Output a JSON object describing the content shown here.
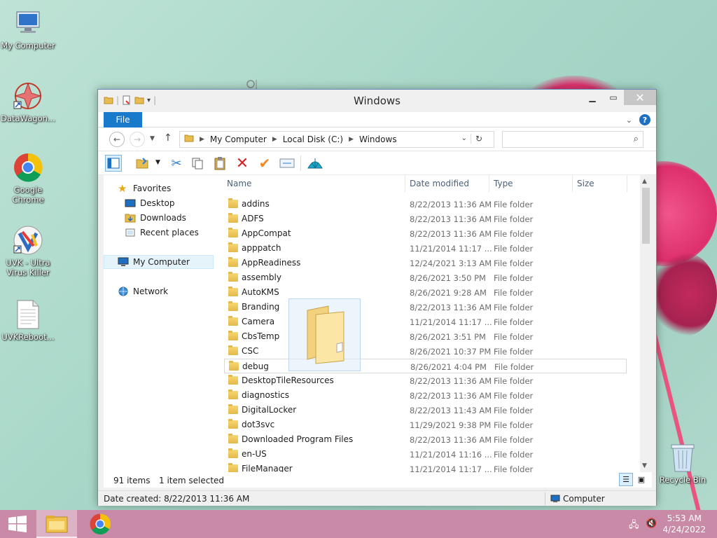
{
  "desktop": {
    "icons": [
      {
        "label": "My Computer",
        "icon": "computer-icon"
      },
      {
        "label": "DataWagon...",
        "icon": "datawagon-icon"
      },
      {
        "label": "Google Chrome",
        "icon": "chrome-icon"
      },
      {
        "label": "UVK - Ultra Virus Killer",
        "icon": "uvk-icon"
      },
      {
        "label": "UVKReboot...",
        "icon": "text-file-icon"
      },
      {
        "label": "Recycle Bin",
        "icon": "recycle-bin-icon"
      }
    ]
  },
  "window": {
    "title": "Windows",
    "file_tab": "File",
    "address": {
      "crumbs": [
        "My Computer",
        "Local Disk (C:)",
        "Windows"
      ]
    },
    "search_placeholder": "",
    "nav": {
      "favorites": "Favorites",
      "desktop": "Desktop",
      "downloads": "Downloads",
      "recent": "Recent places",
      "mycomputer": "My Computer",
      "network": "Network"
    },
    "columns": {
      "name": "Name",
      "date": "Date modified",
      "type": "Type",
      "size": "Size"
    },
    "rows": [
      {
        "name": "addins",
        "date": "8/22/2013 11:36 AM",
        "type": "File folder"
      },
      {
        "name": "ADFS",
        "date": "8/22/2013 11:36 AM",
        "type": "File folder"
      },
      {
        "name": "AppCompat",
        "date": "8/22/2013 11:36 AM",
        "type": "File folder"
      },
      {
        "name": "apppatch",
        "date": "11/21/2014 11:17 ...",
        "type": "File folder"
      },
      {
        "name": "AppReadiness",
        "date": "12/24/2021 3:13 AM",
        "type": "File folder"
      },
      {
        "name": "assembly",
        "date": "8/26/2021 3:50 PM",
        "type": "File folder"
      },
      {
        "name": "AutoKMS",
        "date": "8/26/2021 9:28 AM",
        "type": "File folder"
      },
      {
        "name": "Branding",
        "date": "8/22/2013 11:36 AM",
        "type": "File folder"
      },
      {
        "name": "Camera",
        "date": "11/21/2014 11:17 ...",
        "type": "File folder"
      },
      {
        "name": "CbsTemp",
        "date": "8/26/2021 3:51 PM",
        "type": "File folder"
      },
      {
        "name": "CSC",
        "date": "8/26/2021 10:37 PM",
        "type": "File folder"
      },
      {
        "name": "debug",
        "date": "8/26/2021 4:04 PM",
        "type": "File folder"
      },
      {
        "name": "DesktopTileResources",
        "date": "8/22/2013 11:36 AM",
        "type": "File folder"
      },
      {
        "name": "diagnostics",
        "date": "8/22/2013 11:36 AM",
        "type": "File folder"
      },
      {
        "name": "DigitalLocker",
        "date": "8/22/2013 11:43 AM",
        "type": "File folder"
      },
      {
        "name": "dot3svc",
        "date": "11/29/2021 9:38 PM",
        "type": "File folder"
      },
      {
        "name": "Downloaded Program Files",
        "date": "8/22/2013 11:36 AM",
        "type": "File folder"
      },
      {
        "name": "en-US",
        "date": "11/21/2014 11:16 ...",
        "type": "File folder"
      },
      {
        "name": "FileManager",
        "date": "11/21/2014 11:17 ...",
        "type": "File folder"
      }
    ],
    "selected_row": "debug",
    "status": {
      "count": "91 items",
      "selected": "1 item selected"
    },
    "details": {
      "date_created": "Date created: 8/22/2013 11:36 AM",
      "location": "Computer"
    }
  },
  "taskbar": {
    "time": "5:53 AM",
    "date": "4/24/2022"
  },
  "colors": {
    "file_tab": "#1979ca",
    "taskbar": "#c98aa8",
    "flower": "#e9407a"
  }
}
